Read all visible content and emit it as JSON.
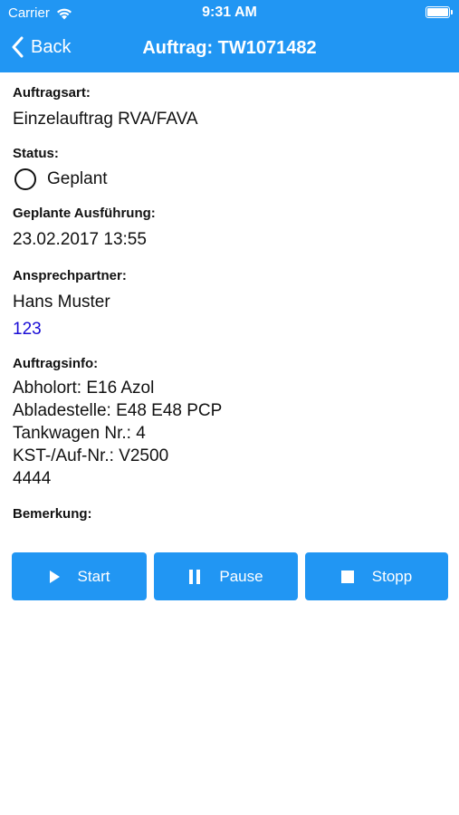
{
  "status_bar": {
    "carrier": "Carrier",
    "time": "9:31 AM"
  },
  "nav": {
    "back_label": "Back",
    "title": "Auftrag: TW1071482"
  },
  "fields": {
    "auftragsart_label": "Auftragsart:",
    "auftragsart_value": "Einzelauftrag RVA/FAVA",
    "status_label": "Status:",
    "status_value": "Geplant",
    "ausfuehrung_label": "Geplante Ausführung:",
    "ausfuehrung_value": "23.02.2017 13:55",
    "ansprechpartner_label": "Ansprechpartner:",
    "ansprechpartner_name": "Hans Muster",
    "ansprechpartner_phone": "123",
    "auftragsinfo_label": "Auftragsinfo:",
    "auftragsinfo_lines": [
      "Abholort:  E16 Azol",
      "Abladestelle: E48 E48 PCP",
      "Tankwagen Nr.: 4",
      "KST-/Auf-Nr.: V2500",
      "4444"
    ],
    "bemerkung_label": "Bemerkung:"
  },
  "actions": {
    "start_label": "Start",
    "pause_label": "Pause",
    "stop_label": "Stopp"
  },
  "colors": {
    "accent": "#2196f3",
    "link": "#1a0dd6"
  }
}
